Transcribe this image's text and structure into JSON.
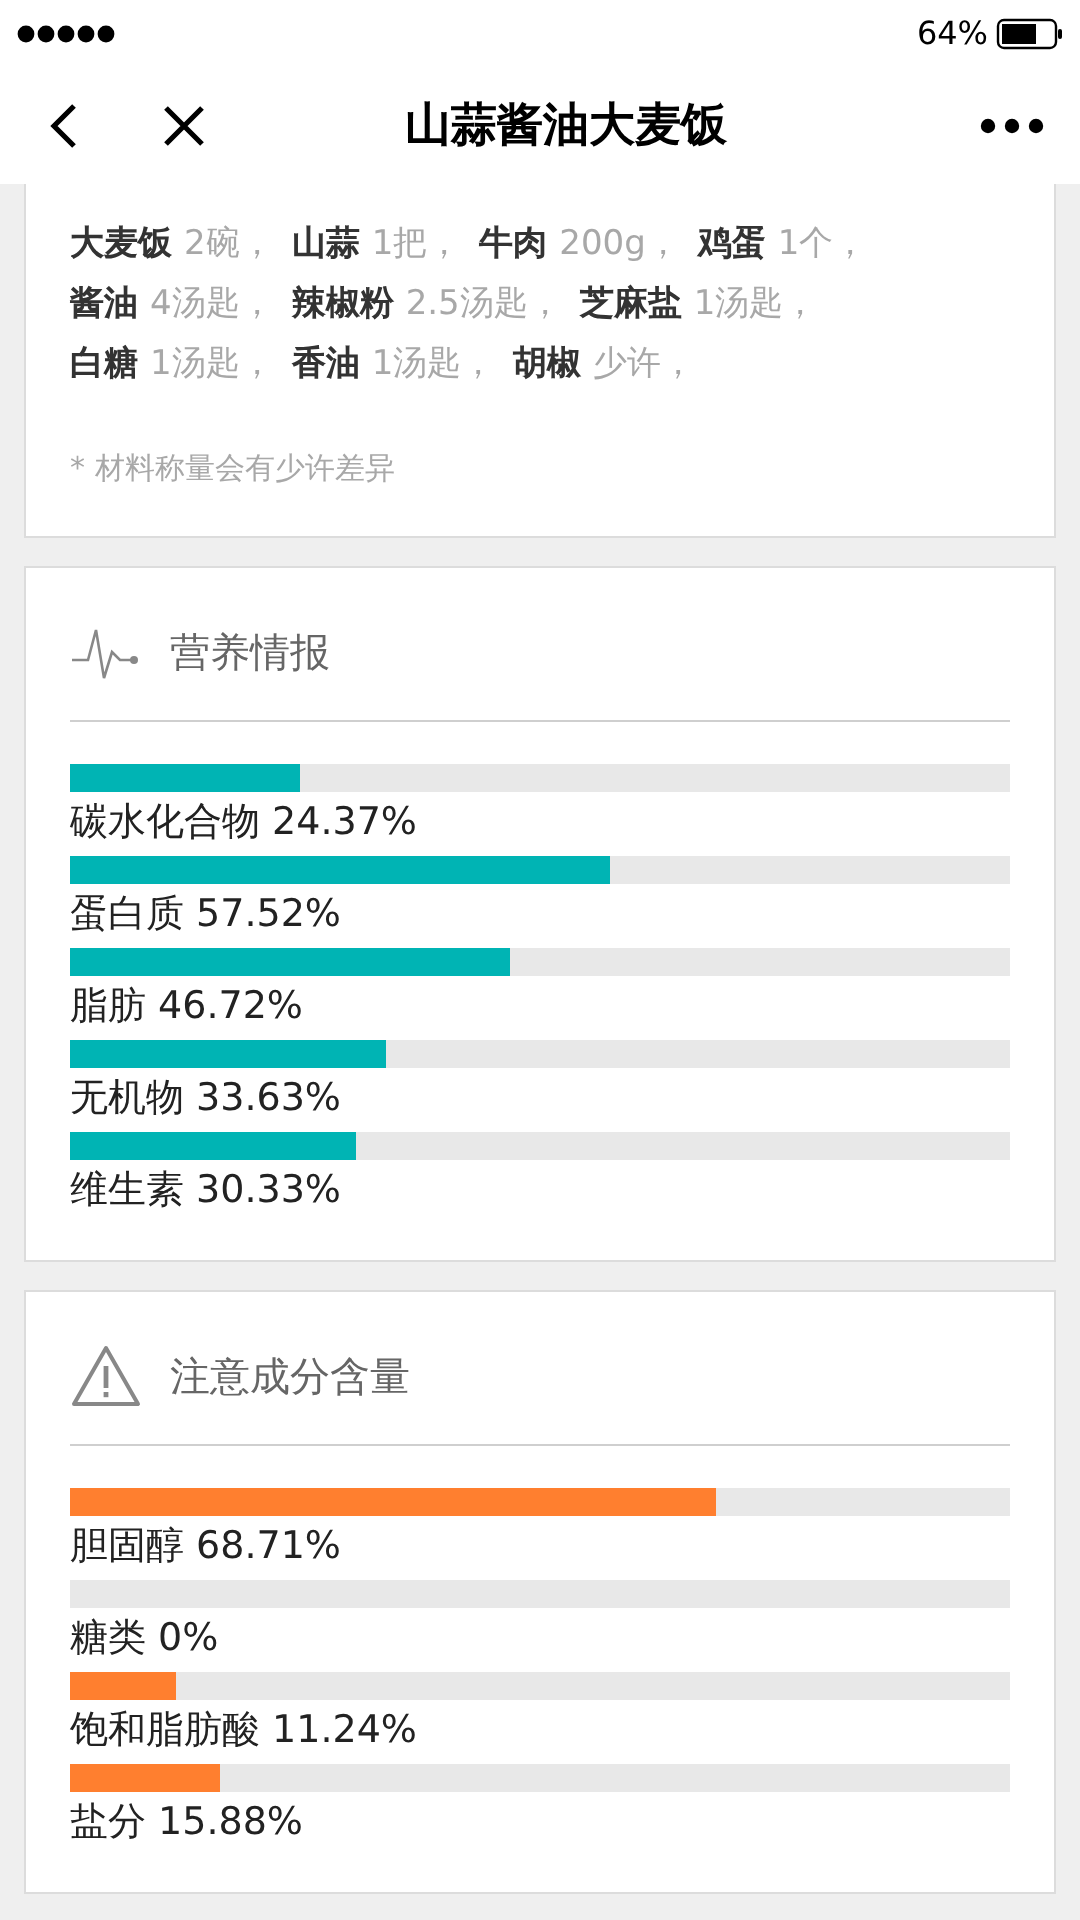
{
  "status_bar": {
    "battery": "64%"
  },
  "nav": {
    "title": "山蒜酱油大麦饭"
  },
  "ingredients": {
    "lines": [
      [
        {
          "name": "大麦饭",
          "amount": "2碗，"
        },
        {
          "name": "山蒜",
          "amount": "1把，"
        },
        {
          "name": "牛肉",
          "amount": "200g，"
        },
        {
          "name": "鸡蛋",
          "amount": "1个，"
        }
      ],
      [
        {
          "name": "酱油",
          "amount": "4汤匙，"
        },
        {
          "name": "辣椒粉",
          "amount": "2.5汤匙，"
        },
        {
          "name": "芝麻盐",
          "amount": "1汤匙，"
        }
      ],
      [
        {
          "name": "白糖",
          "amount": "1汤匙，"
        },
        {
          "name": "香油",
          "amount": "1汤匙，"
        },
        {
          "name": "胡椒",
          "amount": "少许，"
        }
      ]
    ],
    "note": "* 材料称量会有少许差异"
  },
  "sections": [
    {
      "kind": "nutrition",
      "title": "营养情报",
      "color": "#00b4b4",
      "items": [
        {
          "label": "碳水化合物 24.37%",
          "level": 0.2437
        },
        {
          "label": "蛋白质 57.52%",
          "level": 0.5752
        },
        {
          "label": "脂肪 46.72%",
          "level": 0.4672
        },
        {
          "label": "无机物 33.63%",
          "level": 0.3363
        },
        {
          "label": "维生素 30.33%",
          "level": 0.3033
        }
      ]
    },
    {
      "kind": "warning",
      "title": "注意成分含量",
      "color": "#ff7f2f",
      "items": [
        {
          "label": "胆固醇 68.71%",
          "level": 0.6871
        },
        {
          "label": "糖类 0%",
          "level": 0
        },
        {
          "label": "饱和脂肪酸 11.24%",
          "level": 0.1124
        },
        {
          "label": "盐分 15.88%",
          "level": 0.1588
        }
      ]
    }
  ]
}
